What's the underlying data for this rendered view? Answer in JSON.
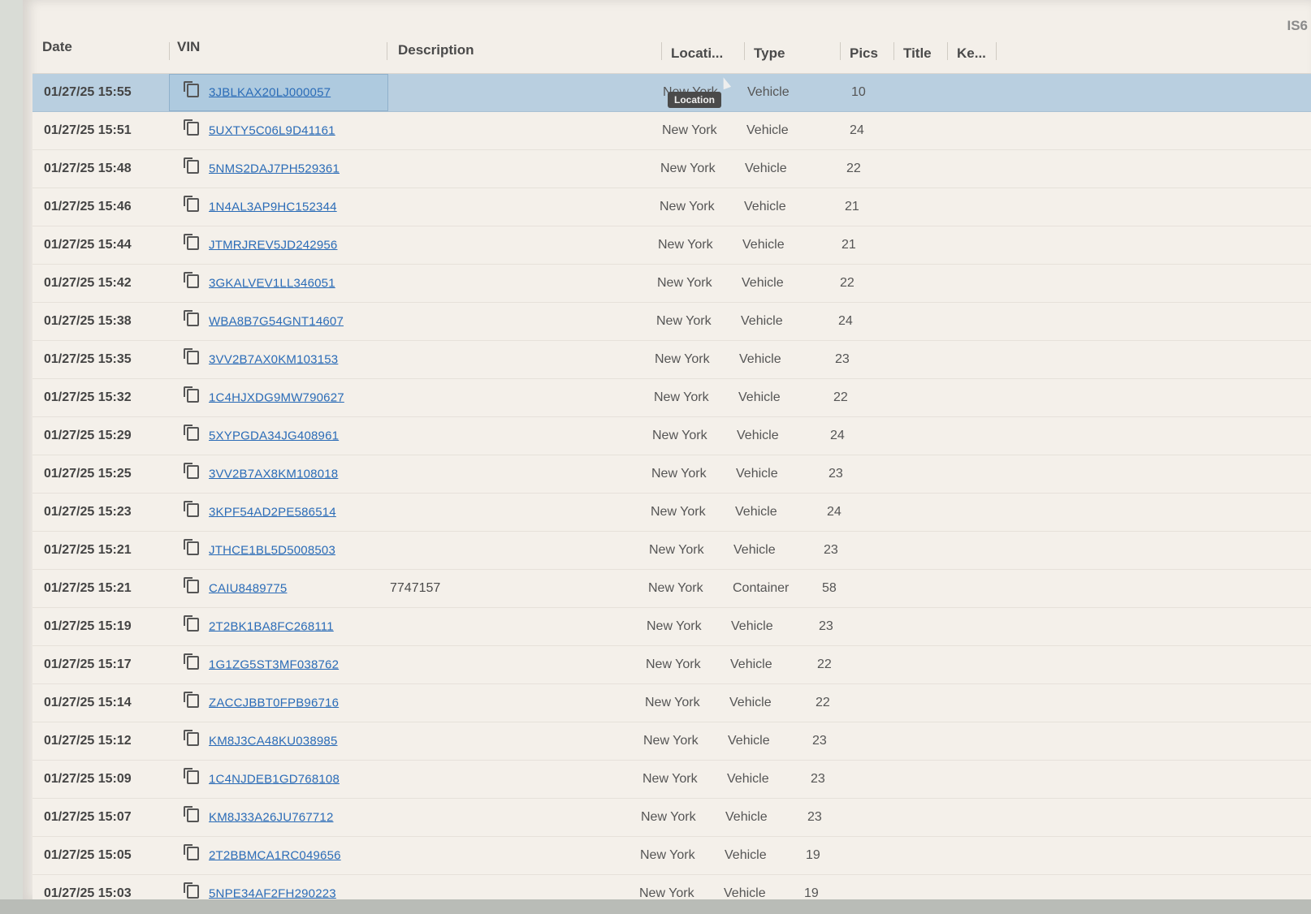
{
  "corner_text": "IS6",
  "columns": {
    "date": "Date",
    "vin": "VIN",
    "description": "Description",
    "location": "Locati...",
    "type": "Type",
    "pics": "Pics",
    "title": "Title",
    "keys": "Ke..."
  },
  "tooltip": "Location",
  "selected_row_index": 0,
  "rows": [
    {
      "date": "01/27/25 15:55",
      "vin": "3JBLKAX20LJ000057",
      "description": "",
      "location": "New York",
      "type": "Vehicle",
      "pics": "10"
    },
    {
      "date": "01/27/25 15:51",
      "vin": "5UXTY5C06L9D41161",
      "description": "",
      "location": "New York",
      "type": "Vehicle",
      "pics": "24"
    },
    {
      "date": "01/27/25 15:48",
      "vin": "5NMS2DAJ7PH529361",
      "description": "",
      "location": "New York",
      "type": "Vehicle",
      "pics": "22"
    },
    {
      "date": "01/27/25 15:46",
      "vin": "1N4AL3AP9HC152344",
      "description": "",
      "location": "New York",
      "type": "Vehicle",
      "pics": "21"
    },
    {
      "date": "01/27/25 15:44",
      "vin": "JTMRJREV5JD242956",
      "description": "",
      "location": "New York",
      "type": "Vehicle",
      "pics": "21"
    },
    {
      "date": "01/27/25 15:42",
      "vin": "3GKALVEV1LL346051",
      "description": "",
      "location": "New York",
      "type": "Vehicle",
      "pics": "22"
    },
    {
      "date": "01/27/25 15:38",
      "vin": "WBA8B7G54GNT14607",
      "description": "",
      "location": "New York",
      "type": "Vehicle",
      "pics": "24"
    },
    {
      "date": "01/27/25 15:35",
      "vin": "3VV2B7AX0KM103153",
      "description": "",
      "location": "New York",
      "type": "Vehicle",
      "pics": "23"
    },
    {
      "date": "01/27/25 15:32",
      "vin": "1C4HJXDG9MW790627",
      "description": "",
      "location": "New York",
      "type": "Vehicle",
      "pics": "22"
    },
    {
      "date": "01/27/25 15:29",
      "vin": "5XYPGDA34JG408961",
      "description": "",
      "location": "New York",
      "type": "Vehicle",
      "pics": "24"
    },
    {
      "date": "01/27/25 15:25",
      "vin": "3VV2B7AX8KM108018",
      "description": "",
      "location": "New York",
      "type": "Vehicle",
      "pics": "23"
    },
    {
      "date": "01/27/25 15:23",
      "vin": "3KPF54AD2PE586514",
      "description": "",
      "location": "New York",
      "type": "Vehicle",
      "pics": "24"
    },
    {
      "date": "01/27/25 15:21",
      "vin": "JTHCE1BL5D5008503",
      "description": "",
      "location": "New York",
      "type": "Vehicle",
      "pics": "23"
    },
    {
      "date": "01/27/25 15:21",
      "vin": "CAIU8489775",
      "description": "7747157",
      "location": "New York",
      "type": "Container",
      "pics": "58"
    },
    {
      "date": "01/27/25 15:19",
      "vin": "2T2BK1BA8FC268111",
      "description": "",
      "location": "New York",
      "type": "Vehicle",
      "pics": "23"
    },
    {
      "date": "01/27/25 15:17",
      "vin": "1G1ZG5ST3MF038762",
      "description": "",
      "location": "New York",
      "type": "Vehicle",
      "pics": "22"
    },
    {
      "date": "01/27/25 15:14",
      "vin": "ZACCJBBT0FPB96716",
      "description": "",
      "location": "New York",
      "type": "Vehicle",
      "pics": "22"
    },
    {
      "date": "01/27/25 15:12",
      "vin": "KM8J3CA48KU038985",
      "description": "",
      "location": "New York",
      "type": "Vehicle",
      "pics": "23"
    },
    {
      "date": "01/27/25 15:09",
      "vin": "1C4NJDEB1GD768108",
      "description": "",
      "location": "New York",
      "type": "Vehicle",
      "pics": "23"
    },
    {
      "date": "01/27/25 15:07",
      "vin": "KM8J33A26JU767712",
      "description": "",
      "location": "New York",
      "type": "Vehicle",
      "pics": "23"
    },
    {
      "date": "01/27/25 15:05",
      "vin": "2T2BBMCA1RC049656",
      "description": "",
      "location": "New York",
      "type": "Vehicle",
      "pics": "19"
    },
    {
      "date": "01/27/25 15:03",
      "vin": "5NPE34AF2FH290223",
      "description": "",
      "location": "New York",
      "type": "Vehicle",
      "pics": "19"
    }
  ]
}
